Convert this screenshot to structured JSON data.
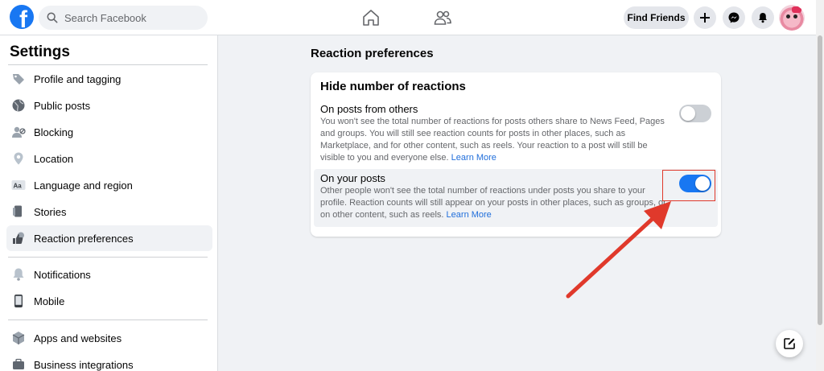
{
  "header": {
    "logo_letter": "f",
    "search_placeholder": "Search Facebook",
    "find_friends_label": "Find Friends",
    "icons": [
      "home-icon",
      "friends-icon",
      "plus-icon",
      "messenger-icon",
      "notifications-icon"
    ]
  },
  "sidebar": {
    "title": "Settings",
    "items": [
      {
        "label": "Profile and tagging",
        "icon": "tag-icon"
      },
      {
        "label": "Public posts",
        "icon": "globe-icon"
      },
      {
        "label": "Blocking",
        "icon": "blocking-icon"
      },
      {
        "label": "Location",
        "icon": "location-icon"
      },
      {
        "label": "Language and region",
        "icon": "language-icon"
      },
      {
        "label": "Stories",
        "icon": "stories-icon"
      },
      {
        "label": "Reaction preferences",
        "icon": "reaction-icon",
        "active": true
      },
      {
        "label": "Notifications",
        "icon": "bell-icon"
      },
      {
        "label": "Mobile",
        "icon": "mobile-icon"
      },
      {
        "label": "Apps and websites",
        "icon": "apps-icon"
      },
      {
        "label": "Business integrations",
        "icon": "business-icon"
      }
    ]
  },
  "main": {
    "title": "Reaction preferences",
    "card": {
      "title": "Hide number of reactions",
      "settings": [
        {
          "title": "On posts from others",
          "description": "You won't see the total number of reactions for posts others share to News Feed, Pages and groups. You will still see reaction counts for posts in other places, such as Marketplace, and for other content, such as reels. Your reaction to a post will still be visible to you and everyone else.",
          "link": "Learn More",
          "enabled": false
        },
        {
          "title": "On your posts",
          "description": "Other people won't see the total number of reactions under posts you share to your profile. Reaction counts will still appear on your posts in other places, such as groups, or on other content, such as reels.",
          "link": "Learn More",
          "enabled": true
        }
      ]
    }
  },
  "colors": {
    "brand": "#1877f2",
    "annotation": "#e0392b"
  }
}
